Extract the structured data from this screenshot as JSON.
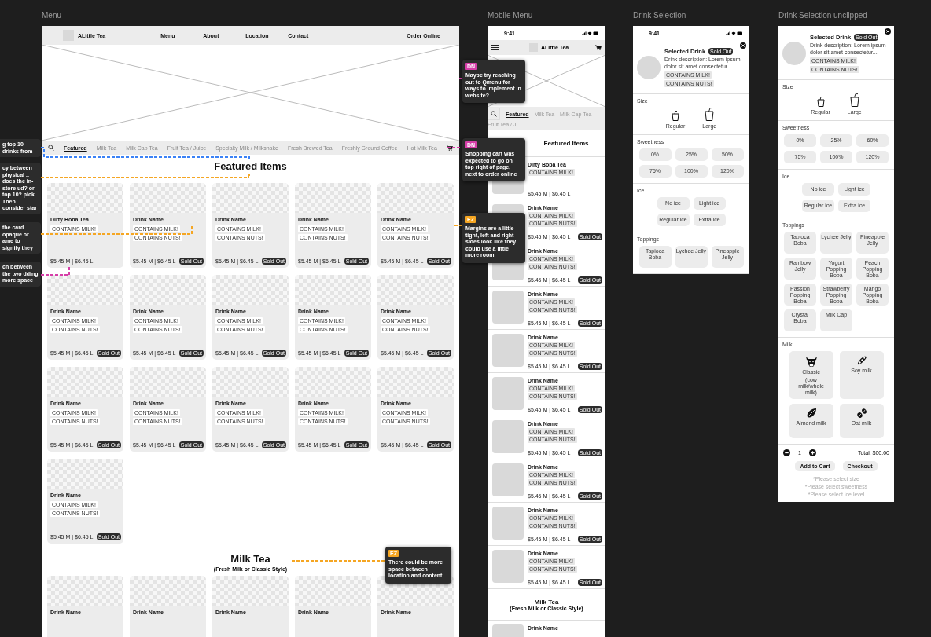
{
  "frames": {
    "menu": "Menu",
    "mobile": "Mobile Menu",
    "drink": "Drink Selection",
    "drink_unclipped": "Drink Selection unclipped"
  },
  "menu": {
    "brand": "ALittle Tea",
    "nav": [
      "Menu",
      "About",
      "Location",
      "Contact"
    ],
    "order_button": "Order Online",
    "categories": [
      {
        "label": "Featured",
        "selected": true
      },
      {
        "label": "Milk Tea",
        "selected": false
      },
      {
        "label": "Milk Cap Tea",
        "selected": false
      },
      {
        "label": "Fruit Tea / Juice",
        "selected": false
      },
      {
        "label": "Specialty Milk / Milkshake",
        "selected": false
      },
      {
        "label": "Fresh Brewed Tea",
        "selected": false
      },
      {
        "label": "Freshly Ground Coffee",
        "selected": false
      },
      {
        "label": "Hot Milk Tea",
        "selected": false
      }
    ],
    "sections": [
      {
        "title": "Featured Items",
        "cards": [
          {
            "name": "Dirty Boba Tea",
            "tags": [
              "CONTAINS MILK!"
            ],
            "price": "$5.45 M | $6.45 L"
          },
          {
            "name": "Drink Name",
            "tags": [
              "CONTAINS MILK!",
              "CONTAINS NUTS!"
            ],
            "price": "$5.45 M | $6.45 L",
            "badge": "Sold Out"
          },
          {
            "name": "Drink Name",
            "tags": [
              "CONTAINS MILK!",
              "CONTAINS NUTS!"
            ],
            "price": "$5.45 M | $6.45 L",
            "badge": "Sold Out"
          },
          {
            "name": "Drink Name",
            "tags": [
              "CONTAINS MILK!",
              "CONTAINS NUTS!"
            ],
            "price": "$5.45 M | $6.45 L",
            "badge": "Sold Out"
          },
          {
            "name": "Drink Name",
            "tags": [
              "CONTAINS MILK!",
              "CONTAINS NUTS!"
            ],
            "price": "$5.45 M | $6.45 L",
            "badge": "Sold Out"
          },
          {
            "name": "Drink Name",
            "tags": [
              "CONTAINS MILK!",
              "CONTAINS NUTS!"
            ],
            "price": "$5.45 M | $6.45 L",
            "badge": "Sold Out"
          },
          {
            "name": "Drink Name",
            "tags": [
              "CONTAINS MILK!",
              "CONTAINS NUTS!"
            ],
            "price": "$5.45 M | $6.45 L",
            "badge": "Sold Out"
          },
          {
            "name": "Drink Name",
            "tags": [
              "CONTAINS MILK!",
              "CONTAINS NUTS!"
            ],
            "price": "$5.45 M | $6.45 L",
            "badge": "Sold Out"
          },
          {
            "name": "Drink Name",
            "tags": [
              "CONTAINS MILK!",
              "CONTAINS NUTS!"
            ],
            "price": "$5.45 M | $6.45 L",
            "badge": "Sold Out"
          },
          {
            "name": "Drink Name",
            "tags": [
              "CONTAINS MILK!",
              "CONTAINS NUTS!"
            ],
            "price": "$5.45 M | $6.45 L",
            "badge": "Sold Out"
          },
          {
            "name": "Drink Name",
            "tags": [
              "CONTAINS MILK!",
              "CONTAINS NUTS!"
            ],
            "price": "$5.45 M | $6.45 L",
            "badge": "Sold Out"
          },
          {
            "name": "Drink Name",
            "tags": [
              "CONTAINS MILK!",
              "CONTAINS NUTS!"
            ],
            "price": "$5.45 M | $6.45 L",
            "badge": "Sold Out"
          },
          {
            "name": "Drink Name",
            "tags": [
              "CONTAINS MILK!",
              "CONTAINS NUTS!"
            ],
            "price": "$5.45 M | $6.45 L",
            "badge": "Sold Out"
          },
          {
            "name": "Drink Name",
            "tags": [
              "CONTAINS MILK!",
              "CONTAINS NUTS!"
            ],
            "price": "$5.45 M | $6.45 L",
            "badge": "Sold Out"
          },
          {
            "name": "Drink Name",
            "tags": [
              "CONTAINS MILK!",
              "CONTAINS NUTS!"
            ],
            "price": "$5.45 M | $6.45 L",
            "badge": "Sold Out"
          },
          {
            "name": "Drink Name",
            "tags": [
              "CONTAINS MILK!",
              "CONTAINS NUTS!"
            ],
            "price": "$5.45 M | $6.45 L",
            "badge": "Sold Out"
          }
        ]
      },
      {
        "title": "Milk Tea",
        "subtitle": "(Fresh Milk or Classic Style)",
        "cards": [
          {
            "name": "Drink Name"
          },
          {
            "name": "Drink Name"
          },
          {
            "name": "Drink Name"
          },
          {
            "name": "Drink Name"
          },
          {
            "name": "Drink Name"
          }
        ]
      }
    ]
  },
  "mobile": {
    "time": "9:41",
    "brand": "ALittle Tea",
    "categories": [
      {
        "label": "Featured",
        "selected": true
      },
      {
        "label": "Milk Tea",
        "selected": false
      },
      {
        "label": "Milk Cap Tea",
        "selected": false
      },
      {
        "label": "Fruit Tea / J",
        "selected": false
      }
    ],
    "sections": [
      {
        "title": "Featured Items",
        "items": [
          {
            "name": "Dirty Boba Tea",
            "tags": [
              "CONTAINS MILK!"
            ],
            "price": "$5.45 M | $6.45 L"
          },
          {
            "name": "Drink Name",
            "tags": [
              "CONTAINS MILK!",
              "CONTAINS NUTS!"
            ],
            "price": "$5.45 M | $6.45 L",
            "badge": "Sold Out"
          },
          {
            "name": "Drink Name",
            "tags": [
              "CONTAINS MILK!",
              "CONTAINS NUTS!"
            ],
            "price": "$5.45 M | $6.45 L",
            "badge": "Sold Out"
          },
          {
            "name": "Drink Name",
            "tags": [
              "CONTAINS MILK!",
              "CONTAINS NUTS!"
            ],
            "price": "$5.45 M | $6.45 L",
            "badge": "Sold Out"
          },
          {
            "name": "Drink Name",
            "tags": [
              "CONTAINS MILK!",
              "CONTAINS NUTS!"
            ],
            "price": "$5.45 M | $6.45 L",
            "badge": "Sold Out"
          },
          {
            "name": "Drink Name",
            "tags": [
              "CONTAINS MILK!",
              "CONTAINS NUTS!"
            ],
            "price": "$5.45 M | $6.45 L",
            "badge": "Sold Out"
          },
          {
            "name": "Drink Name",
            "tags": [
              "CONTAINS MILK!",
              "CONTAINS NUTS!"
            ],
            "price": "$5.45 M | $6.45 L",
            "badge": "Sold Out"
          },
          {
            "name": "Drink Name",
            "tags": [
              "CONTAINS MILK!",
              "CONTAINS NUTS!"
            ],
            "price": "$5.45 M | $6.45 L",
            "badge": "Sold Out"
          },
          {
            "name": "Drink Name",
            "tags": [
              "CONTAINS MILK!",
              "CONTAINS NUTS!"
            ],
            "price": "$5.45 M | $6.45 L",
            "badge": "Sold Out"
          },
          {
            "name": "Drink Name",
            "tags": [
              "CONTAINS MILK!",
              "CONTAINS NUTS!"
            ],
            "price": "$5.45 M | $6.45 L",
            "badge": "Sold Out"
          }
        ]
      },
      {
        "title": "Milk Tea",
        "subtitle": "(Fresh Milk or Classic Style)",
        "items": [
          {
            "name": "Drink Name"
          }
        ]
      }
    ]
  },
  "drink_selection": {
    "time": "9:41",
    "title": "Selected Drink",
    "badge": "Sold Out",
    "description": "Drink description: Lorem ipsum dolor sit amet consectetur...",
    "tags": [
      "CONTAINS MILK!",
      "CONTAINS NUTS!"
    ],
    "size": {
      "label": "Size",
      "options": [
        "Regular",
        "Large"
      ]
    },
    "sweetness": {
      "label": "Sweetness",
      "options": [
        "0%",
        "25%",
        "50%",
        "75%",
        "100%",
        "120%"
      ]
    },
    "ice": {
      "label": "Ice",
      "options": [
        "No ice",
        "Light ice",
        "Regular ice",
        "Extra ice"
      ]
    },
    "toppings": {
      "label": "Toppings",
      "options": [
        "Tapioca Boba",
        "Lychee Jelly",
        "Pineapple Jelly"
      ]
    }
  },
  "drink_selection_unclipped": {
    "title": "Selected Drink",
    "badge": "Sold Out",
    "description": "Drink description: Lorem ipsum dolor sit amet consectetur...",
    "tags": [
      "CONTAINS MILK!",
      "CONTAINS NUTS!"
    ],
    "size": {
      "label": "Size",
      "options": [
        "Regular",
        "Large"
      ]
    },
    "sweetness": {
      "label": "Sweetness",
      "options": [
        "0%",
        "25%",
        "60%",
        "75%",
        "100%",
        "120%"
      ]
    },
    "ice": {
      "label": "Ice",
      "options": [
        "No ice",
        "Light ice",
        "Regular ice",
        "Extra ice"
      ]
    },
    "toppings": {
      "label": "Toppings",
      "options": [
        "Tapioca Boba",
        "Lychee Jelly",
        "Pineapple Jelly",
        "Rainbow Jelly",
        "Yogurt Popping Boba",
        "Peach Popping Boba",
        "Passion Popping Boba",
        "Strawberry Popping Boba",
        "Mango Popping Boba",
        "Crystal Boba",
        "Milk Cap"
      ]
    },
    "milk": {
      "label": "Milk",
      "options": [
        {
          "label": "Classic",
          "note": "(cow milk/whole milk)"
        },
        {
          "label": "Soy milk"
        },
        {
          "label": "Almond milk"
        },
        {
          "label": "Oat milk"
        }
      ]
    },
    "quantity": "1",
    "total": "Total: $00.00",
    "buttons": [
      "Add to Cart",
      "Checkout"
    ],
    "warnings": [
      "*Please select size",
      "*Please select sweetness",
      "*Please select ice level"
    ]
  },
  "comments": [
    {
      "badge": "DN",
      "color": "#d63ea8",
      "text": "Maybe try reaching out to Qmenu for ways to implement in website?"
    },
    {
      "badge": "DN",
      "color": "#d63ea8",
      "text": "Shopping cart was expected to go on top right of page, next to order online"
    },
    {
      "badge": "EZ",
      "color": "#f5a623",
      "text": "Margins are a little tight, left and right sides look like they could use a little more room"
    },
    {
      "badge": "EZ",
      "color": "#f5a623",
      "text": "There could be more space between location and content"
    }
  ],
  "side_comments": [
    {
      "color": "#3b82f6",
      "text": "g top 10 drinks from"
    },
    {
      "color": "#f5a623",
      "text": "cy between physical .. does the in-store ud? or top 10? pick Then consider star"
    },
    {
      "color": "#f5a623",
      "text": "the card opaque or ame to signify they"
    },
    {
      "color": "#d63ea8",
      "text": "ch between the two dding more space"
    }
  ]
}
